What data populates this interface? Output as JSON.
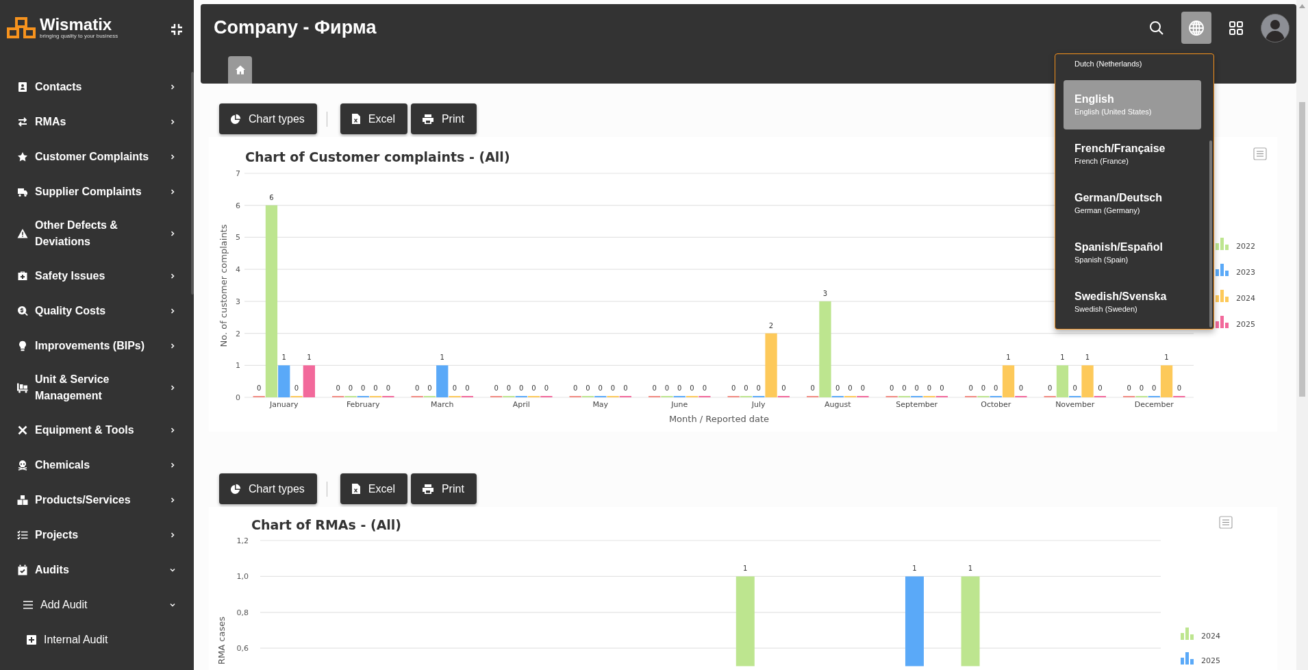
{
  "sidebar": {
    "logo": {
      "name": "Wismatix",
      "tagline": "bringing quality to your business"
    },
    "items": [
      {
        "label": "Contacts",
        "expanded": false
      },
      {
        "label": "RMAs",
        "expanded": false
      },
      {
        "label": "Customer Complaints",
        "expanded": false
      },
      {
        "label": "Supplier Complaints",
        "expanded": false
      },
      {
        "label": "Other Defects & Deviations",
        "expanded": false
      },
      {
        "label": "Safety Issues",
        "expanded": false
      },
      {
        "label": "Quality Costs",
        "expanded": false
      },
      {
        "label": "Improvements (BIPs)",
        "expanded": false
      },
      {
        "label": "Unit & Service Management",
        "expanded": false
      },
      {
        "label": "Equipment & Tools",
        "expanded": false
      },
      {
        "label": "Chemicals",
        "expanded": false
      },
      {
        "label": "Products/Services",
        "expanded": false
      },
      {
        "label": "Projects",
        "expanded": false
      },
      {
        "label": "Audits",
        "expanded": true,
        "children": [
          {
            "label": "Add Audit",
            "expanded": true,
            "children": [
              {
                "label": "Internal Audit"
              }
            ]
          }
        ]
      }
    ]
  },
  "header": {
    "title": "Company - Фирма",
    "actions": [
      {
        "kind": "search",
        "selected": false
      },
      {
        "kind": "language",
        "selected": true
      },
      {
        "kind": "apps",
        "selected": false
      },
      {
        "kind": "avatar",
        "selected": false
      }
    ],
    "tabs": [
      {
        "kind": "home",
        "selected": true
      }
    ]
  },
  "language_menu": {
    "items": [
      {
        "subtitle": "Dutch (Netherlands)",
        "selected": false
      },
      {
        "name": "English",
        "subtitle": "English (United States)",
        "selected": true
      },
      {
        "name": "French/Française",
        "subtitle": "French (France)",
        "selected": false
      },
      {
        "name": "German/Deutsch",
        "subtitle": "German (Germany)",
        "selected": false
      },
      {
        "name": "Spanish/Español",
        "subtitle": "Spanish (Spain)",
        "selected": false
      },
      {
        "name": "Swedish/Svenska",
        "subtitle": "Swedish (Sweden)",
        "selected": false
      }
    ]
  },
  "sections": [
    {
      "toolbar": [
        {
          "kind": "chart",
          "label": "Chart types"
        },
        {
          "kind": "excel",
          "label": "Excel"
        },
        {
          "kind": "print",
          "label": "Print"
        }
      ],
      "chart_data": {
        "type": "bar",
        "title": "Chart of Customer complaints - (All)",
        "xlabel": "Month / Reported date",
        "ylabel": "No. of customer complaints",
        "categories": [
          "January",
          "February",
          "March",
          "April",
          "May",
          "June",
          "July",
          "August",
          "September",
          "October",
          "November",
          "December"
        ],
        "series": [
          {
            "color": "#f28b82",
            "values": [
              0,
              0,
              0,
              0,
              0,
              0,
              0,
              0,
              0,
              0,
              0,
              0
            ]
          },
          {
            "name": "2022",
            "color": "#bde58f",
            "values": [
              6,
              0,
              0,
              0,
              0,
              0,
              0,
              3,
              0,
              0,
              1,
              0
            ]
          },
          {
            "name": "2023",
            "color": "#5aa9f8",
            "values": [
              1,
              0,
              1,
              0,
              0,
              0,
              0,
              0,
              0,
              0,
              0,
              0
            ]
          },
          {
            "name": "2024",
            "color": "#fdc95a",
            "values": [
              0,
              0,
              0,
              0,
              0,
              0,
              2,
              0,
              0,
              1,
              1,
              1
            ]
          },
          {
            "name": "2025",
            "color": "#f2699b",
            "values": [
              1,
              0,
              0,
              0,
              0,
              0,
              0,
              0,
              0,
              0,
              0,
              0
            ]
          }
        ],
        "ylim": [
          0,
          7
        ],
        "yticks": [
          0,
          1,
          2,
          3,
          4,
          5,
          6,
          7
        ],
        "grid": true,
        "legend": "right",
        "data_labels": true
      }
    },
    {
      "toolbar": [
        {
          "kind": "chart",
          "label": "Chart types"
        },
        {
          "kind": "excel",
          "label": "Excel"
        },
        {
          "kind": "print",
          "label": "Print"
        }
      ],
      "chart_data": {
        "type": "bar",
        "title": "Chart of RMAs - (All)",
        "ylabel": "RMA cases",
        "series": [
          {
            "name": "2024",
            "color": "#bde58f",
            "values": [
              null,
              null,
              null,
              null,
              null,
              null,
              1,
              null,
              null,
              1,
              null,
              null
            ]
          },
          {
            "name": "2025",
            "color": "#5aa9f8",
            "values": [
              null,
              null,
              null,
              null,
              null,
              null,
              null,
              null,
              1,
              null,
              null,
              null
            ]
          }
        ],
        "ylim": [
          0.5,
          1.2
        ],
        "yticks": [
          {
            "value": 1.2,
            "label": "1,2"
          },
          {
            "value": 1,
            "label": "1,0"
          },
          {
            "value": 0.8,
            "label": "0,8"
          },
          {
            "value": 0.6,
            "label": "0,6"
          }
        ],
        "grid": true,
        "legend": "right",
        "data_labels": true
      }
    }
  ]
}
